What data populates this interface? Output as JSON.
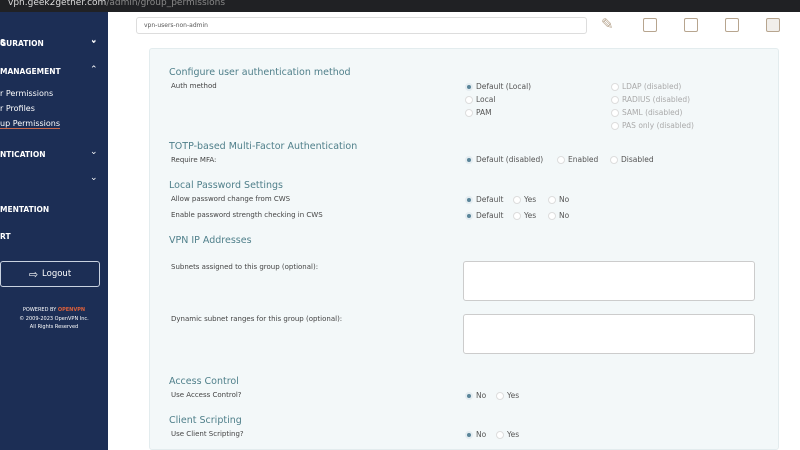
{
  "browser": {
    "url_host": "vpn.geek2gether.com",
    "url_path": "/admin/group_permissions"
  },
  "sidebar": {
    "items": [
      {
        "label": "S",
        "chevron": "down"
      },
      {
        "label": "GURATION",
        "chevron": "down"
      },
      {
        "label": "MANAGEMENT",
        "chevron": "up"
      },
      {
        "label": "NTICATION",
        "chevron": "down"
      },
      {
        "label": "",
        "chevron": "down"
      },
      {
        "label": "MENTATION"
      },
      {
        "label": "RT"
      }
    ],
    "subitems": [
      "r Permissions",
      "r Profiles",
      "up Permissions"
    ],
    "logout": "Logout",
    "powered_by": "POWERED BY",
    "brand": "OPENVPN",
    "copyright": "© 2009-2023 OpenVPN Inc.",
    "rights": "All Rights Reserved"
  },
  "group_name": "vpn-users-non-admin",
  "sections": {
    "auth": {
      "title": "Configure user authentication method",
      "label": "Auth method",
      "options": [
        "Default (Local)",
        "Local",
        "PAM"
      ],
      "disabled_options": [
        "LDAP (disabled)",
        "RADIUS (disabled)",
        "SAML (disabled)",
        "PAS only (disabled)"
      ]
    },
    "mfa": {
      "title": "TOTP-based Multi-Factor Authentication",
      "label": "Require MFA:",
      "options": [
        "Default (disabled)",
        "Enabled",
        "Disabled"
      ]
    },
    "pwd": {
      "title": "Local Password Settings",
      "row1": "Allow password change from CWS",
      "row2": "Enable password strength checking in CWS",
      "options": [
        "Default",
        "Yes",
        "No"
      ]
    },
    "vpnip": {
      "title": "VPN IP Addresses",
      "subnets": "Subnets assigned to this group (optional):",
      "dynamic": "Dynamic subnet ranges for this group (optional):"
    },
    "access": {
      "title": "Access Control",
      "label": "Use Access Control?",
      "options": [
        "No",
        "Yes"
      ]
    },
    "scripting": {
      "title": "Client Scripting",
      "label": "Use Client Scripting?",
      "options": [
        "No",
        "Yes"
      ]
    }
  }
}
